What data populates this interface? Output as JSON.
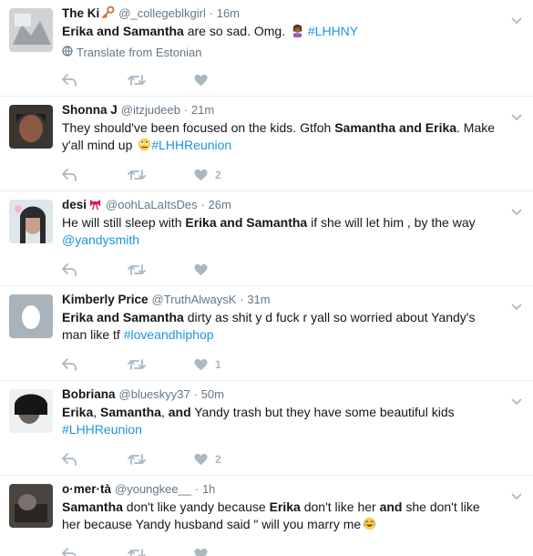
{
  "colors": {
    "link": "#1b95e0",
    "muted": "#657786",
    "action": "#aab8c2",
    "divider": "#e6ecf0"
  },
  "tweets": [
    {
      "name": "The Ki",
      "name_emoji": "key-emoji",
      "handle": "@_collegeblkgirl",
      "sep": "·",
      "time": "16m",
      "text_parts": [
        {
          "t": "Erika and Samantha",
          "b": true
        },
        {
          "t": " are so sad. Omg. "
        },
        {
          "t": "",
          "emoji": "woman-facepalming-emoji"
        },
        {
          "t": " "
        },
        {
          "t": "#LHHNY",
          "link": true
        }
      ],
      "translate": "Translate from Estonian",
      "likes": ""
    },
    {
      "name": "Shonna J",
      "handle": "@itzjudeeb",
      "sep": "·",
      "time": "21m",
      "text_parts": [
        {
          "t": "They should've been focused on the kids. Gtfoh "
        },
        {
          "t": "Samantha and Erika",
          "b": true
        },
        {
          "t": ". Make y'all mind up "
        },
        {
          "t": "",
          "emoji": "rolling-eyes-emoji"
        },
        {
          "t": "#LHHReunion",
          "link": true
        }
      ],
      "likes": "2"
    },
    {
      "name": "desi",
      "name_emoji": "ribbon-emoji",
      "handle": "@oohLaLaItsDes",
      "sep": "·",
      "time": "26m",
      "text_parts": [
        {
          "t": "He will still sleep with "
        },
        {
          "t": "Erika and Samantha",
          "b": true
        },
        {
          "t": " if she will let him , by the way "
        },
        {
          "t": "@yandysmith",
          "link": true
        }
      ],
      "likes": ""
    },
    {
      "name": "Kimberly Price",
      "handle": "@TruthAlwaysK",
      "sep": "·",
      "time": "31m",
      "text_parts": [
        {
          "t": "Erika and Samantha",
          "b": true
        },
        {
          "t": " dirty as shit y d fuck r yall so worried about Yandy's man like tf "
        },
        {
          "t": "#loveandhiphop",
          "link": true
        }
      ],
      "likes": "1"
    },
    {
      "name": "Bobriana",
      "handle": "@blueskyy37",
      "sep": "·",
      "time": "50m",
      "text_parts": [
        {
          "t": "Erika",
          "b": true
        },
        {
          "t": ", "
        },
        {
          "t": "Samantha",
          "b": true
        },
        {
          "t": ", "
        },
        {
          "t": "and",
          "b": true
        },
        {
          "t": " Yandy trash but they have some beautiful kids "
        },
        {
          "t": "#LHHReunion",
          "link": true
        }
      ],
      "likes": "2"
    },
    {
      "name": "o·mer·tà",
      "handle": "@youngkee__",
      "sep": "·",
      "time": "1h",
      "text_parts": [
        {
          "t": "Samantha",
          "b": true
        },
        {
          "t": " don't like yandy because "
        },
        {
          "t": "Erika",
          "b": true
        },
        {
          "t": " don't like her "
        },
        {
          "t": "and",
          "b": true
        },
        {
          "t": " she don't like her because Yandy husband said \" will you marry me"
        },
        {
          "t": "",
          "emoji": "tears-of-joy-emoji"
        }
      ],
      "likes": ""
    }
  ]
}
